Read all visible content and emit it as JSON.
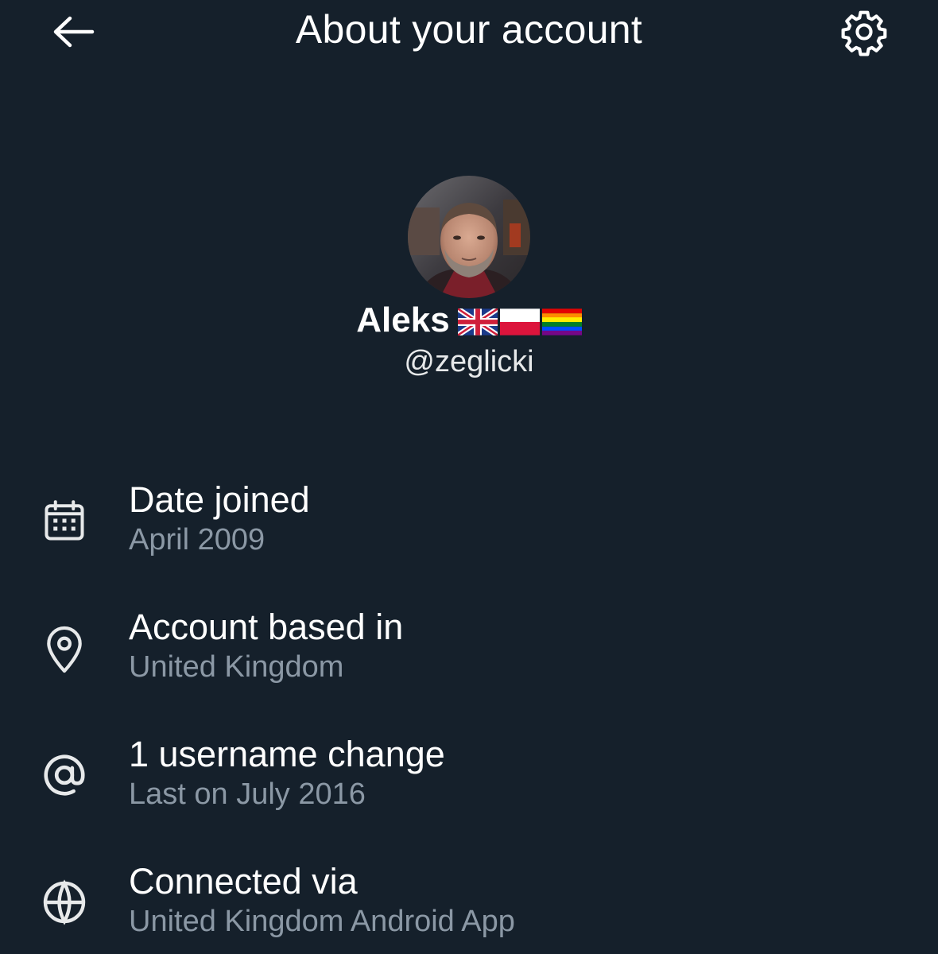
{
  "header": {
    "title": "About your account",
    "back_icon": "arrow-left-icon",
    "settings_icon": "gear-icon"
  },
  "profile": {
    "display_name": "Aleks",
    "flags": [
      "uk-flag",
      "poland-flag",
      "rainbow-flag"
    ],
    "handle": "@zeglicki"
  },
  "info": [
    {
      "icon": "calendar-icon",
      "title": "Date joined",
      "subtitle": "April 2009"
    },
    {
      "icon": "location-pin-icon",
      "title": "Account based in",
      "subtitle": "United Kingdom"
    },
    {
      "icon": "at-sign-icon",
      "title": "1 username change",
      "subtitle": "Last on July 2016"
    },
    {
      "icon": "globe-icon",
      "title": "Connected via",
      "subtitle": "United Kingdom Android App"
    }
  ],
  "colors": {
    "background": "#15202b",
    "primary_text": "#ffffff",
    "secondary_text": "#8b98a5"
  }
}
